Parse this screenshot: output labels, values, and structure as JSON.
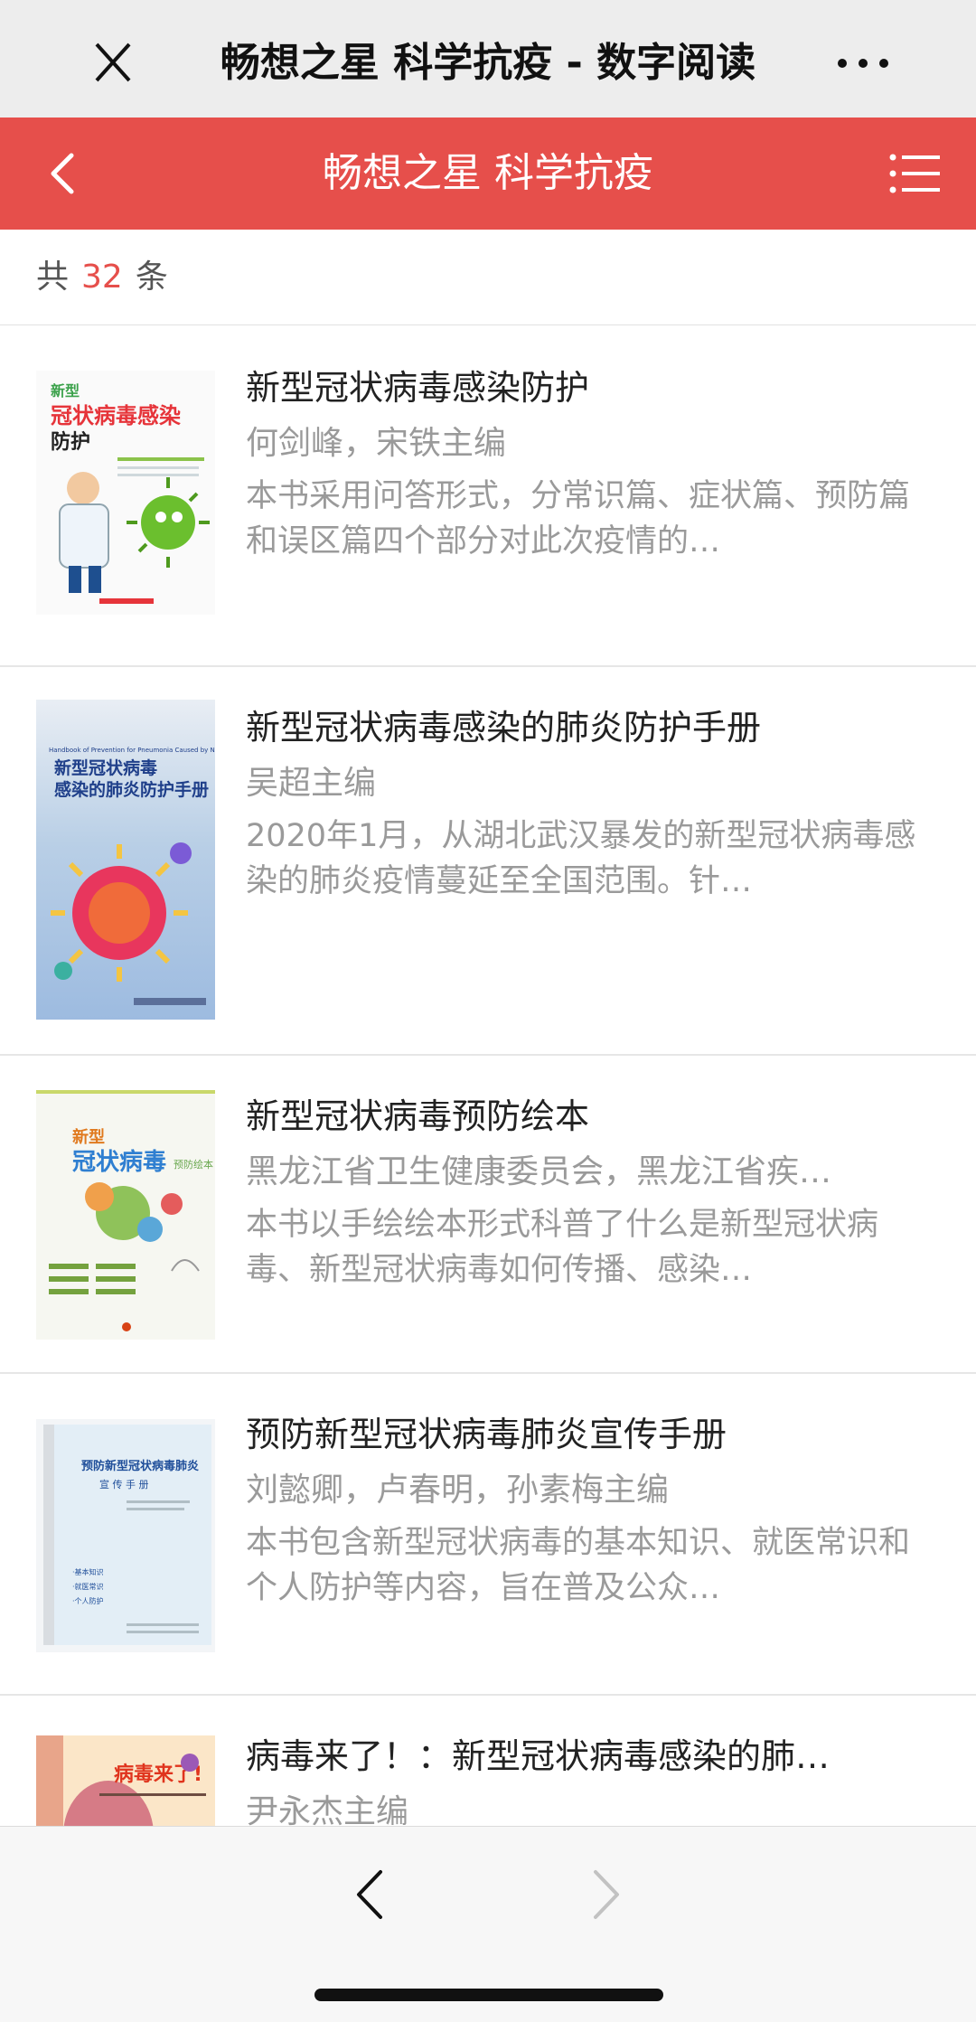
{
  "topbar": {
    "title": "畅想之星 科学抗疫 - 数字阅读",
    "close_icon": "close-icon",
    "more_icon": "more-dots-icon"
  },
  "header": {
    "title": "畅想之星 科学抗疫",
    "back_icon": "back-chevron-icon",
    "menu_icon": "list-menu-icon",
    "color": "#e64f4b"
  },
  "count": {
    "prefix": "共",
    "number": "32",
    "suffix": "条"
  },
  "books": [
    {
      "title": "新型冠状病毒感染防护",
      "author": "何剑峰，宋铁主编",
      "desc": "本书采用问答形式，分常识篇、症状篇、预防篇和误区篇四个部分对此次疫情的…",
      "cover_text": [
        "新型",
        "冠状病毒感染",
        "防护"
      ]
    },
    {
      "title": "新型冠状病毒感染的肺炎防护手册",
      "author": "吴超主编",
      "desc": "2020年1月，从湖北武汉暴发的新型冠状病毒感染的肺炎疫情蔓延至全国范围。针…",
      "cover_text": [
        "Handbook of Prevention for Pneumonia Caused by Novel Coronavirus",
        "新型冠状病毒",
        "感染的肺炎防护手册"
      ]
    },
    {
      "title": "新型冠状病毒预防绘本",
      "author": "黑龙江省卫生健康委员会，黑龙江省疾…",
      "desc": "本书以手绘绘本形式科普了什么是新型冠状病毒、新型冠状病毒如何传播、感染…",
      "cover_text": [
        "新型",
        "冠状病毒",
        "预防绘本"
      ]
    },
    {
      "title": "预防新型冠状病毒肺炎宣传手册",
      "author": "刘懿卿，卢春明，孙素梅主编",
      "desc": "本书包含新型冠状病毒的基本知识、就医常识和个人防护等内容，旨在普及公众…",
      "cover_text": [
        "预防新型冠状病毒肺炎",
        "宣 传 手 册",
        "·基本知识",
        "·就医常识",
        "·个人防护"
      ]
    },
    {
      "title": "病毒来了！：新型冠状病毒感染的肺…",
      "author": "尹永杰主编",
      "desc": "",
      "cover_text": [
        "病毒来了!"
      ]
    }
  ],
  "bottom": {
    "prev_icon": "prev-arrow-icon",
    "next_icon": "next-arrow-icon"
  }
}
